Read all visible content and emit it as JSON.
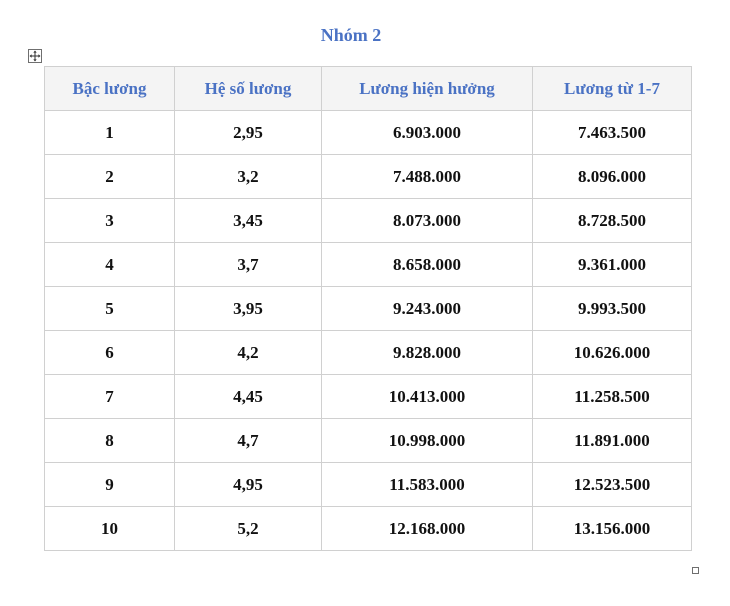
{
  "title": "Nhóm 2",
  "table": {
    "headers": [
      "Bậc lương",
      "Hệ số lương",
      "Lương hiện hưởng",
      "Lương từ 1-7"
    ],
    "rows": [
      [
        "1",
        "2,95",
        "6.903.000",
        "7.463.500"
      ],
      [
        "2",
        "3,2",
        "7.488.000",
        "8.096.000"
      ],
      [
        "3",
        "3,45",
        "8.073.000",
        "8.728.500"
      ],
      [
        "4",
        "3,7",
        "8.658.000",
        "9.361.000"
      ],
      [
        "5",
        "3,95",
        "9.243.000",
        "9.993.500"
      ],
      [
        "6",
        "4,2",
        "9.828.000",
        "10.626.000"
      ],
      [
        "7",
        "4,45",
        "10.413.000",
        "11.258.500"
      ],
      [
        "8",
        "4,7",
        "10.998.000",
        "11.891.000"
      ],
      [
        "9",
        "4,95",
        "11.583.000",
        "12.523.500"
      ],
      [
        "10",
        "5,2",
        "12.168.000",
        "13.156.000"
      ]
    ]
  },
  "colors": {
    "accent": "#4a72c4",
    "header_bg": "#f4f4f4",
    "border": "#d0d0d0",
    "text": "#111111"
  },
  "icons": {
    "move_handle": "move-arrows-icon",
    "resize_handle": "resize-handle-icon"
  }
}
